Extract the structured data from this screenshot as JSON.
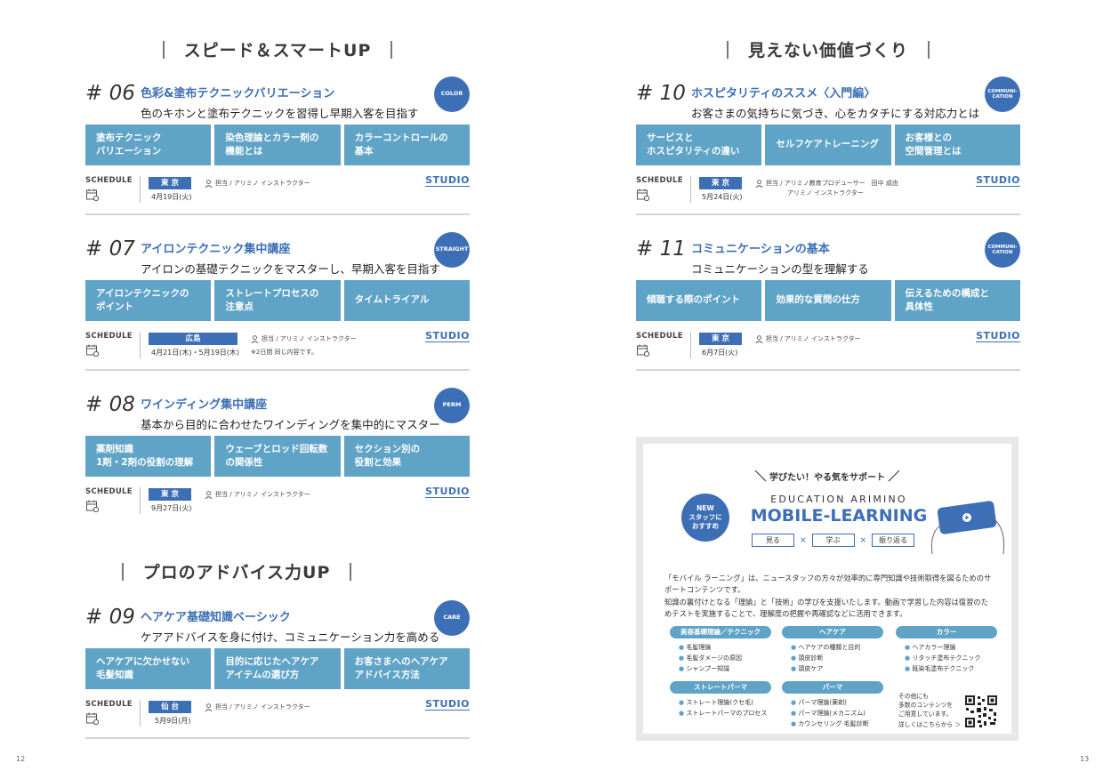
{
  "left": {
    "section1_title": "スピード＆スマートUP",
    "section2_title": "プロのアドバイス力UP",
    "page_number": "12"
  },
  "right": {
    "section_title": "見えない価値づくり",
    "page_number": "13"
  },
  "schedule_label": "SCHEDULE",
  "studio_label": "STUDIO",
  "courses": [
    {
      "num": "# 06",
      "title": "色彩&塗布テクニックバリエーション",
      "subtitle": "色のキホンと塗布テクニックを習得し早期入客を目指す",
      "badge": "COLOR",
      "topics": [
        "塗布テクニック\nバリエーション",
        "染色理論とカラー剤の\n機能とは",
        "カラーコントロールの\n基本"
      ],
      "location": "東 京",
      "date": "4月19日(火)",
      "instructor": "担当 / アリミノ インストラクター"
    },
    {
      "num": "# 07",
      "title": "アイロンテクニック集中講座",
      "subtitle": "アイロンの基礎テクニックをマスターし、早期入客を目指す",
      "badge": "STRAIGHT",
      "topics": [
        "アイロンテクニックの\nポイント",
        "ストレートプロセスの\n注意点",
        "タイムトライアル"
      ],
      "location": "広島",
      "date": "4月21日(木)・5月19日(木)",
      "instructor": "担当 / アリミノ インストラクター",
      "note": "※2日間 同じ内容です。"
    },
    {
      "num": "# 08",
      "title": "ワインディング集中講座",
      "subtitle": "基本から目的に合わせたワインディングを集中的にマスター",
      "badge": "PERM",
      "topics": [
        "薬剤知識\n1剤・2剤の役割の理解",
        "ウェーブとロッド回転数\nの関係性",
        "セクション別の\n役割と効果"
      ],
      "location": "東 京",
      "date": "9月27日(火)",
      "instructor": "担当 / アリミノ インストラクター"
    },
    {
      "num": "# 09",
      "title": "ヘアケア基礎知識ベーシック",
      "subtitle": "ケアアドバイスを身に付け、コミュニケーション力を高める",
      "badge": "CARE",
      "topics": [
        "ヘアケアに欠かせない\n毛髪知識",
        "目的に応じたヘアケア\nアイテムの選び方",
        "お客さまへのヘアケア\nアドバイス方法"
      ],
      "location": "仙 台",
      "date": "5月9日(月)",
      "instructor": "担当 / アリミノ インストラクター"
    },
    {
      "num": "# 10",
      "title": "ホスピタリティのススメ〈入門編〉",
      "subtitle": "お客さまの気持ちに気づき、心をカタチにする対応力とは",
      "badge": "COMMUNI-\nCATION",
      "topics": [
        "サービスと\nホスピタリティの違い",
        "セルフケアトレーニング",
        "お客様との\n空間管理とは"
      ],
      "location": "東 京",
      "date": "5月24日(火)",
      "instructor": "担当 / アリミノ教育プロデューサー　田中 成由",
      "instructor2": "アリミノ インストラクター"
    },
    {
      "num": "# 11",
      "title": "コミュニケーションの基本",
      "subtitle": "コミュニケーションの型を理解する",
      "badge": "COMMUNI-\nCATION",
      "topics": [
        "傾聴する際のポイント",
        "効果的な質問の仕方",
        "伝えるための構成と\n具体性"
      ],
      "location": "東 京",
      "date": "6月7日(火)",
      "instructor": "担当 / アリミノ インストラクター"
    }
  ],
  "mobile": {
    "tagline": "学びたい！やる気をサポート",
    "brand": "EDUCATION ARIMINO",
    "title": "MOBILE-LEARNING",
    "new_badge": "NEW\nスタッフに\nおすすめ",
    "actions": [
      "見る",
      "学ぶ",
      "振り返る"
    ],
    "times": "×",
    "description": "「モバイル ラーニング」は、ニュースタッフの方々が効率的に専門知識や技術取得を図るためのサポートコンテンツです。\n知識の裏付けとなる「理論」と「技術」の学びを支援いたします。動画で学習した内容は復習のためテストを実施することで、理解度の把握や再確認などに活用できます。",
    "categories": [
      {
        "name": "美容基礎理論／テクニック",
        "items": [
          "毛髪理論",
          "毛髪ダメージの原因",
          "シャンプー知識"
        ]
      },
      {
        "name": "ヘアケア",
        "items": [
          "ヘアケアの種類と目的",
          "頭皮診断",
          "頭皮ケア"
        ]
      },
      {
        "name": "カラー",
        "items": [
          "ヘアカラー理論",
          "リタッチ塗布テクニック",
          "既染毛塗布テクニック"
        ]
      },
      {
        "name": "ストレートパーマ",
        "items": [
          "ストレート理論(クセ毛)",
          "ストレートパーマのプロセス"
        ]
      },
      {
        "name": "パーマ",
        "items": [
          "パーマ理論(薬剤)",
          "パーマ理論(メカニズム)",
          "カウンセリング 毛髪診断"
        ]
      }
    ],
    "more_text": "その他にも\n多数のコンテンツを\nご用意しています。",
    "more_link": "詳しくはこちらから ＞",
    "accent": "#3d6fb6",
    "topic_color": "#5fa3c6"
  }
}
